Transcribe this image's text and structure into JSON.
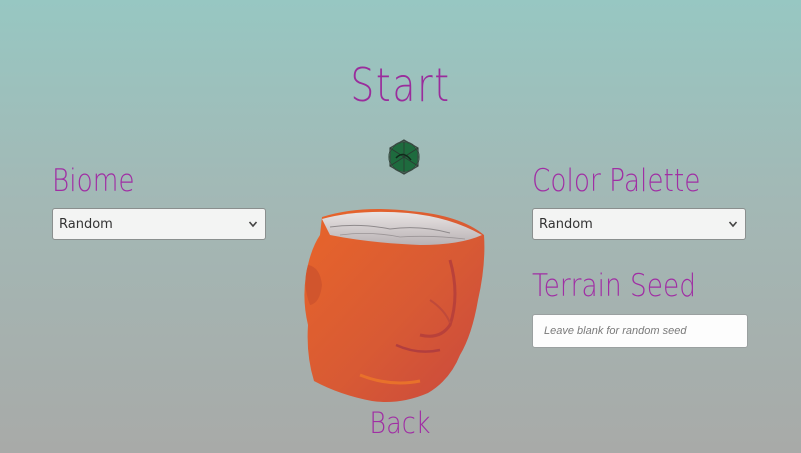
{
  "screen": {
    "title": "Start",
    "back_label": "Back"
  },
  "biome": {
    "label": "Biome",
    "selected": "Random"
  },
  "color_palette": {
    "label": "Color Palette",
    "selected": "Random"
  },
  "terrain_seed": {
    "label": "Terrain Seed",
    "value": "",
    "placeholder": "Leave blank for random seed"
  },
  "icons": {
    "orb": "globe-orb-icon",
    "dropdown": "chevron-down-icon",
    "preview": "terrain-head-preview"
  },
  "colors": {
    "accent": "#a02ea4",
    "head": "#e0602c",
    "orb": "#1e6b3e"
  }
}
